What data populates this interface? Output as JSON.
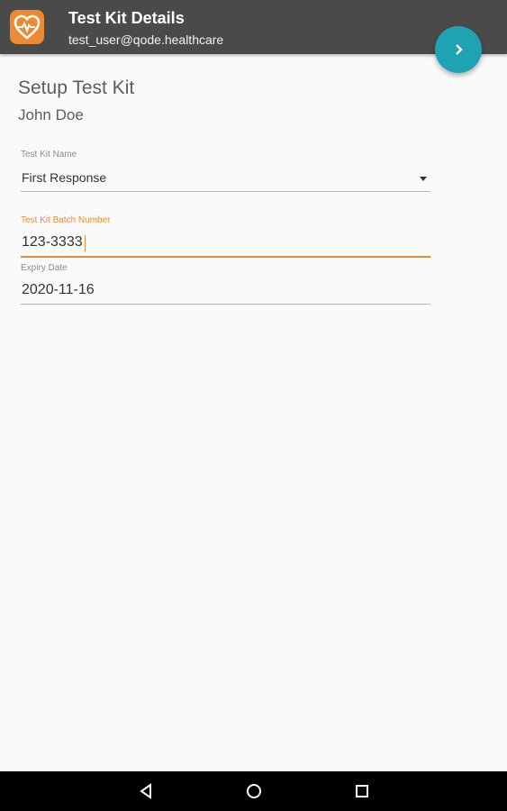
{
  "appbar": {
    "title": "Test Kit Details",
    "subtitle": "test_user@qode.healthcare",
    "logo_icon": "heart-pulse-icon",
    "background": "#4a4a4a",
    "logo_color": "#ef8a34"
  },
  "fab": {
    "icon": "chevron-right-icon",
    "color": "#1fa3b3"
  },
  "content": {
    "title": "Setup Test Kit",
    "patient_name": "John Doe"
  },
  "form": {
    "kit_name": {
      "label": "Test Kit Name",
      "value": "First Response"
    },
    "batch_number": {
      "label": "Test Kit Batch Number",
      "value": "123-3333",
      "focused": true
    },
    "expiry_date": {
      "label": "Expiry Date",
      "value": "2020-11-16"
    }
  },
  "theme": {
    "accent": "#ef8a34",
    "text": "#5c5c5c"
  },
  "navbar": {
    "back_icon": "back-triangle-icon",
    "home_icon": "home-circle-icon",
    "recents_icon": "recents-square-icon"
  }
}
